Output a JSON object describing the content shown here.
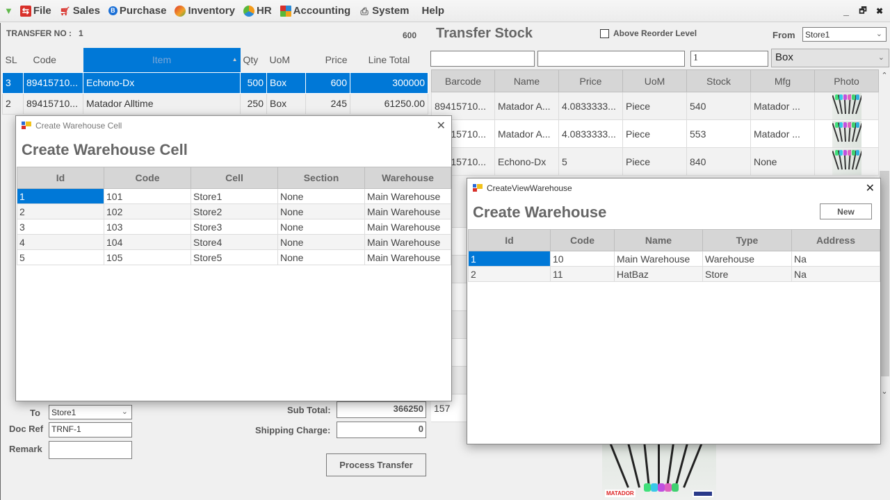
{
  "menubar": {
    "items": [
      {
        "label": "File",
        "icon": "file-icon"
      },
      {
        "label": "Sales",
        "icon": "sales-cart-icon"
      },
      {
        "label": "Purchase",
        "icon": "purchase-icon"
      },
      {
        "label": "Inventory",
        "icon": "inventory-icon"
      },
      {
        "label": "HR",
        "icon": "hr-icon"
      },
      {
        "label": "Accounting",
        "icon": "accounting-icon"
      },
      {
        "label": "System",
        "icon": "system-icon"
      },
      {
        "label": "Help",
        "icon": ""
      }
    ],
    "window_controls": {
      "minimize": "_",
      "restore": "🗗",
      "close": "✖"
    }
  },
  "transfer": {
    "label": "TRANSFER NO :",
    "number": "1",
    "top_value": "600",
    "columns": [
      "SL",
      "Code",
      "Item",
      "Qty",
      "UoM",
      "Price",
      "Line Total"
    ],
    "rows": [
      {
        "sl": "3",
        "code": "89415710...",
        "item": "Echono-Dx",
        "qty": "500",
        "uom": "Box",
        "price": "600",
        "total": "300000",
        "selected": true
      },
      {
        "sl": "2",
        "code": "89415710...",
        "item": "Matador Alltime",
        "qty": "250",
        "uom": "Box",
        "price": "245",
        "total": "61250.00",
        "selected": false
      }
    ],
    "to_label": "To",
    "to_value": "Store1",
    "docref_label": "Doc Ref",
    "docref_value": "TRNF-1",
    "remark_label": "Remark",
    "remark_value": "",
    "subtotal_label": "Sub Total:",
    "subtotal_value": "366250",
    "shipping_label": "Shipping Charge:",
    "shipping_value": "0",
    "process_button": "Process Transfer"
  },
  "stock": {
    "title": "Transfer Stock",
    "above_reorder_label": "Above Reorder Level",
    "above_reorder_checked": false,
    "from_label": "From",
    "from_value": "Store1",
    "search_barcode": "",
    "search_name": "",
    "qty_value": "1",
    "uom_value": "Box",
    "columns": [
      "Barcode",
      "Name",
      "Price",
      "UoM",
      "Stock",
      "Mfg",
      "Photo"
    ],
    "rows": [
      {
        "barcode": "89415710...",
        "name": "Matador A...",
        "price": "4.0833333...",
        "uom": "Piece",
        "stock": "540",
        "mfg": "Matador ..."
      },
      {
        "barcode": "89415710...",
        "name": "Matador A...",
        "price": "4.0833333...",
        "uom": "Piece",
        "stock": "553",
        "mfg": "Matador ..."
      },
      {
        "barcode": "89415710...",
        "name": "Echono-Dx",
        "price": "5",
        "uom": "Piece",
        "stock": "840",
        "mfg": "None"
      }
    ],
    "hidden_rows_prefix": [
      "157",
      "157",
      "157",
      "157",
      "157",
      "157",
      "157",
      "157"
    ],
    "product_brand": "MATADOR"
  },
  "cell_dialog": {
    "window_title": "Create Warehouse Cell",
    "heading": "Create Warehouse Cell",
    "columns": [
      "Id",
      "Code",
      "Cell",
      "Section",
      "Warehouse"
    ],
    "rows": [
      {
        "id": "1",
        "code": "101",
        "cell": "Store1",
        "section": "None",
        "warehouse": "Main Warehouse"
      },
      {
        "id": "2",
        "code": "102",
        "cell": "Store2",
        "section": "None",
        "warehouse": "Main Warehouse"
      },
      {
        "id": "3",
        "code": "103",
        "cell": "Store3",
        "section": "None",
        "warehouse": "Main Warehouse"
      },
      {
        "id": "4",
        "code": "104",
        "cell": "Store4",
        "section": "None",
        "warehouse": "Main Warehouse"
      },
      {
        "id": "5",
        "code": "105",
        "cell": "Store5",
        "section": "None",
        "warehouse": "Main Warehouse"
      }
    ]
  },
  "warehouse_dialog": {
    "window_title": "CreateViewWarehouse",
    "heading": "Create Warehouse",
    "new_button": "New",
    "columns": [
      "Id",
      "Code",
      "Name",
      "Type",
      "Address"
    ],
    "rows": [
      {
        "id": "1",
        "code": "10",
        "name": "Main Warehouse",
        "type": "Warehouse",
        "address": "Na"
      },
      {
        "id": "2",
        "code": "11",
        "name": "HatBaz",
        "type": "Store",
        "address": "Na"
      }
    ]
  },
  "colors": {
    "selection": "#0078d7",
    "header_bg": "#d6d6d6",
    "window_bg": "#f0f0f0"
  }
}
